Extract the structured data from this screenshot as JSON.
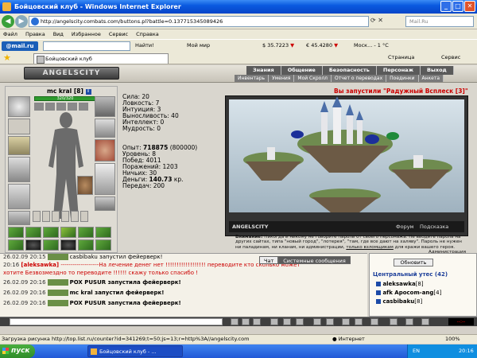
{
  "window": {
    "title": "Бойцовский клуб - Windows Internet Explorer"
  },
  "address": {
    "url": "http://angelscity.combats.com/buttons.pl?battle=0.137715345089426",
    "search_placeholder": "Mail.Ru"
  },
  "menu": [
    "Файл",
    "Правка",
    "Вид",
    "Избранное",
    "Сервис",
    "Справка"
  ],
  "toolbar": {
    "brand": "@mail.ru",
    "find": "Найти!",
    "myworld": "Мой мир",
    "usd": "$ 35.7223",
    "eur": "€ 45.4280",
    "weather": "Моск... - 1 °C"
  },
  "favbar": {
    "tab": "Бойцовский клуб",
    "page": "Страница",
    "service": "Сервис"
  },
  "game": {
    "logo": "ANGELSCITY",
    "topmenu": [
      "Знания",
      "Общение",
      "Безопасность",
      "Персонаж",
      "Выход"
    ],
    "submenu": [
      "Инвентарь",
      "Умения",
      "Мой Скролл",
      "Отчет о переводах",
      "Поединки",
      "Анкета"
    ],
    "char_name": "mc kral",
    "char_level": "[8]",
    "char_info": "i",
    "hp": "320/320",
    "stats": [
      "Сила: 20",
      "Ловкость: 7",
      "Интуиция: 3",
      "Выносливость: 40",
      "Интеллект: 0",
      "Мудрость: 0"
    ],
    "exp_label": "Опыт: ",
    "exp_value": "718875",
    "exp_next": " (800000)",
    "level": "Уровень: 8",
    "wins": "Побед: 4011",
    "losses": "Поражений: 1203",
    "draws": "Ничьих: 30",
    "money_label": "Деньги: ",
    "money_value": "140.73",
    "money_unit": " кр.",
    "transfers": "Передач: 200",
    "scene_title": "Вы запустили \"Радужный Всплеск [3]\"",
    "scene_logo": "ANGELSCITY",
    "scene_forum": "Форум",
    "scene_hint": "Подсказка",
    "warning_title": "Внимание!",
    "warning_text": " Никогда и никому не говорите пароль от своего персонажа. Не вводите пароль на других сайтах, типа \"новый город\", \"лотерея\", \"там, где все дают на халяву\". Пароль не нужен ни паладинам, ни кланам, ни администрации, ",
    "warning_link": "только взломщикам",
    "warning_end": " для кражи вашего героя.",
    "admin_sign": "Администрация",
    "chat_tab": "Чат",
    "sys_tab": "Системные сообщения"
  },
  "chat": [
    {
      "time": "26.02.09 20:15",
      "text": "casbibaku запустил фейерверк!",
      "avatar": true,
      "bold": "casbibaku"
    },
    {
      "time": "20:16",
      "nick": "[aleksawka]",
      "text": "-------------------На лечение денег нет !!!!!!!!!!!!!!!!!! переводите кто сколько может",
      "red": true
    },
    {
      "time": "",
      "text": "хотите Безвозмездно то переводите !!!!!! скажу только спасибо !",
      "red": true
    },
    {
      "time": "26.02.09 20:16",
      "text": "POX PUSUR запустила фейерверк!",
      "avatar": true,
      "bold": "POX PUSUR"
    },
    {
      "time": "26.02.09 20:16",
      "text": "mc kral запустил фейерверк!",
      "avatar": true,
      "bold": "mc kral"
    },
    {
      "time": "26.02.09 20:16",
      "text": "POX PUSUR запустила фейерверк!",
      "avatar": true,
      "bold": "POX PUSUR"
    }
  ],
  "online": {
    "refresh": "Обновить",
    "title": "Центральный утес (42)",
    "users": [
      {
        "name": "aleksawka",
        "lvl": "[8]"
      },
      {
        "name": "afk Apocom-ang",
        "lvl": "[4]"
      },
      {
        "name": "casbibaku",
        "lvl": "[8]"
      }
    ]
  },
  "statusbar": {
    "loading": "Загрузка рисунка http://top.list.ru/counter?id=341269;t=50;js=13;r=http%3A//angelscity.com",
    "zone": "Интернет",
    "zoom": "100%"
  },
  "taskbar": {
    "start": "пуск",
    "item": "Бойцовский клуб - ...",
    "lang": "EN",
    "time": "20:16"
  }
}
